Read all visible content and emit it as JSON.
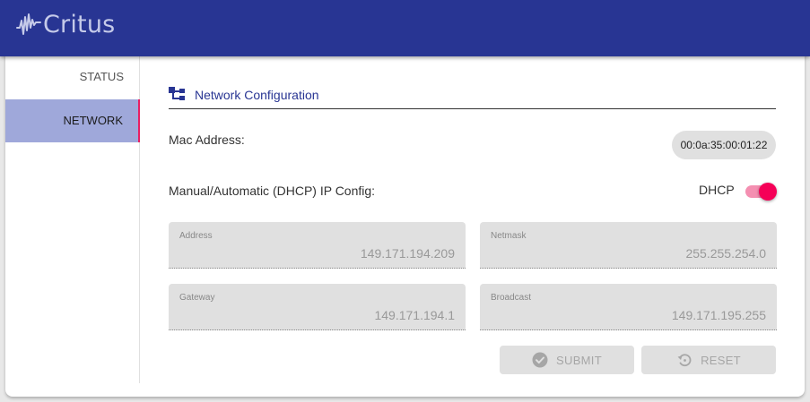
{
  "app": {
    "name": "Critus"
  },
  "sidebar": {
    "items": [
      {
        "label": "STATUS",
        "active": false
      },
      {
        "label": "NETWORK",
        "active": true
      }
    ]
  },
  "section": {
    "title": "Network Configuration",
    "icon": "network-icon"
  },
  "mac": {
    "label": "Mac Address:",
    "value": "00:0a:35:00:01:22"
  },
  "ip_config": {
    "label": "Manual/Automatic (DHCP) IP Config:",
    "switch_label": "DHCP",
    "dhcp_enabled": true
  },
  "fields": {
    "address": {
      "label": "Address",
      "value": "149.171.194.209"
    },
    "netmask": {
      "label": "Netmask",
      "value": "255.255.254.0"
    },
    "gateway": {
      "label": "Gateway",
      "value": "149.171.194.1"
    },
    "broadcast": {
      "label": "Broadcast",
      "value": "149.171.195.255"
    }
  },
  "buttons": {
    "submit_label": "SUBMIT",
    "reset_label": "RESET",
    "submit_icon": "check-circle-icon",
    "reset_icon": "restore-icon"
  },
  "colors": {
    "appbar": "#283593",
    "active_nav": "#9fa8da",
    "accent": "#f50057"
  }
}
